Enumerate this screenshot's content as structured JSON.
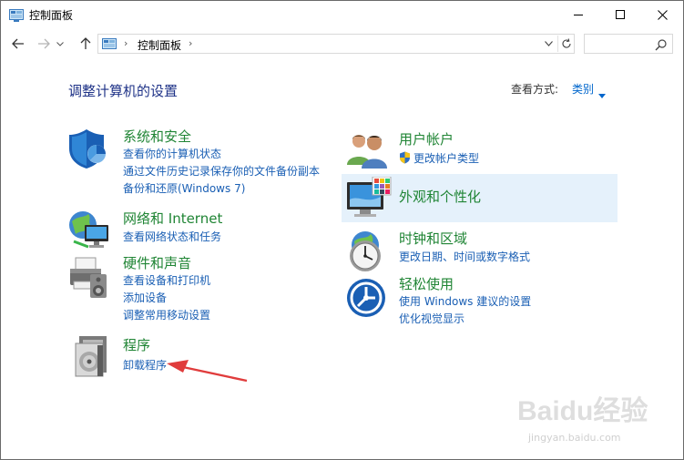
{
  "window": {
    "title": "控制面板",
    "minimize_label": "—",
    "maximize_label": "☐",
    "close_label": "✕"
  },
  "address": {
    "separator": "›",
    "crumb": "控制面板",
    "separator2": "›"
  },
  "search": {
    "placeholder": ""
  },
  "header": {
    "title": "调整计算机的设置",
    "view_by_label": "查看方式:",
    "view_by_value": "类别"
  },
  "categories": {
    "system": {
      "title": "系统和安全",
      "links": [
        "查看你的计算机状态",
        "通过文件历史记录保存你的文件备份副本",
        "备份和还原(Windows 7)"
      ]
    },
    "network": {
      "title": "网络和 Internet",
      "links": [
        "查看网络状态和任务"
      ]
    },
    "hardware": {
      "title": "硬件和声音",
      "links": [
        "查看设备和打印机",
        "添加设备",
        "调整常用移动设置"
      ]
    },
    "programs": {
      "title": "程序",
      "links": [
        "卸载程序"
      ]
    },
    "users": {
      "title": "用户帐户",
      "links": [
        "更改帐户类型"
      ]
    },
    "appearance": {
      "title": "外观和个性化",
      "links": []
    },
    "clock": {
      "title": "时钟和区域",
      "links": [
        "更改日期、时间或数字格式"
      ]
    },
    "ease": {
      "title": "轻松使用",
      "links": [
        "使用 Windows 建议的设置",
        "优化视觉显示"
      ]
    }
  },
  "watermark": {
    "logo": "Baidu经验",
    "sub": "jingyan.baidu.com"
  },
  "colors": {
    "category_title": "#208535",
    "link": "#1a5fb4",
    "page_title": "#1e3287",
    "highlight": "#e5f1fb",
    "annotation_arrow": "#e03c3c"
  }
}
